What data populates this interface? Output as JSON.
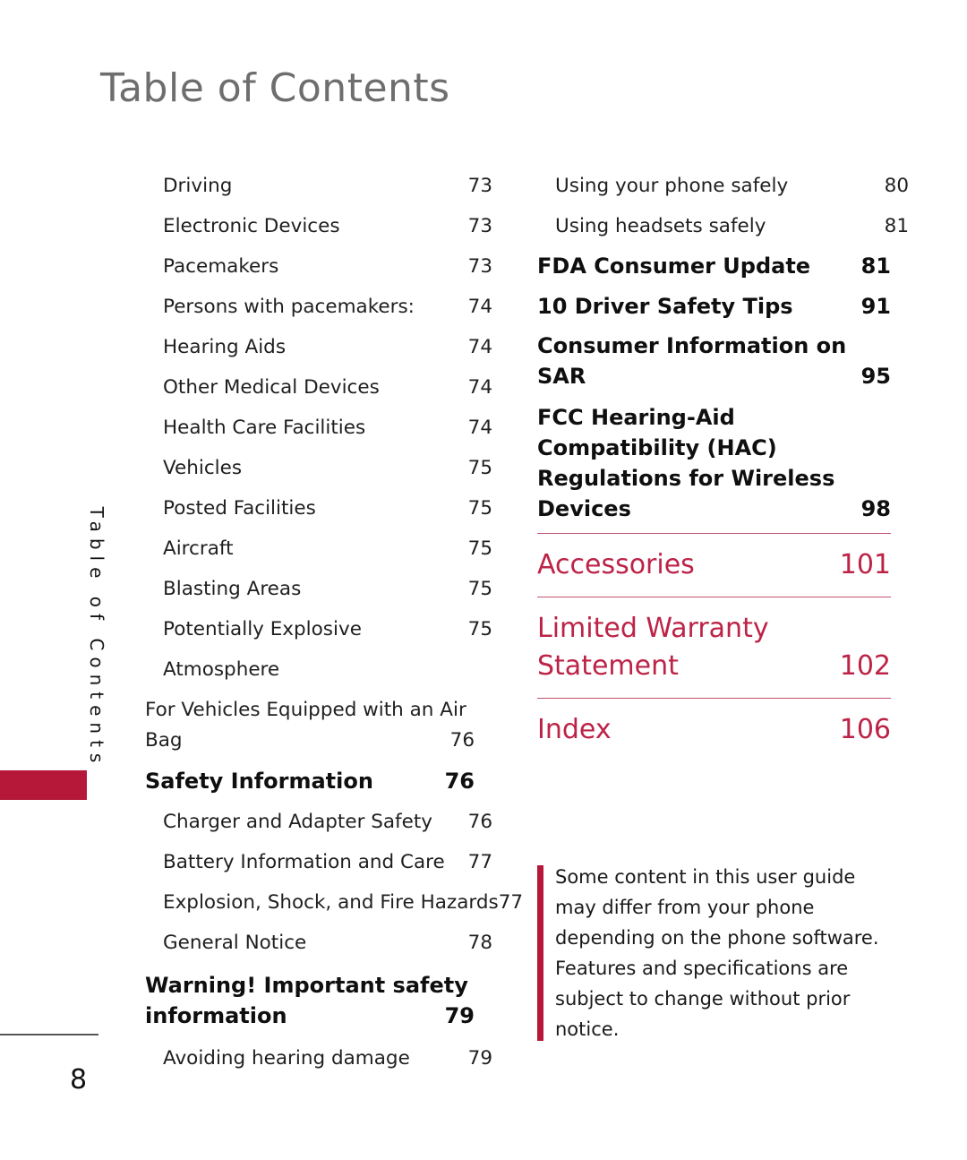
{
  "page": {
    "title": "Table of Contents",
    "side_tab_label": "Table of Contents",
    "page_number": "8",
    "accent_color": "#b51838",
    "major_color": "#bc2347",
    "title_color": "#6e6e6e"
  },
  "left_column": {
    "entries": [
      {
        "label": "Driving",
        "page": "73",
        "level": "sub"
      },
      {
        "label": "Electronic Devices",
        "page": "73",
        "level": "sub"
      },
      {
        "label": "Pacemakers",
        "page": "73",
        "level": "sub"
      },
      {
        "label": "Persons with pacemakers:",
        "page": "74",
        "level": "sub"
      },
      {
        "label": "Hearing Aids",
        "page": "74",
        "level": "sub"
      },
      {
        "label": "Other Medical Devices",
        "page": "74",
        "level": "sub"
      },
      {
        "label": "Health Care Facilities",
        "page": "74",
        "level": "sub"
      },
      {
        "label": "Vehicles",
        "page": "75",
        "level": "sub"
      },
      {
        "label": "Posted Facilities",
        "page": "75",
        "level": "sub"
      },
      {
        "label": "Aircraft",
        "page": "75",
        "level": "sub"
      },
      {
        "label": "Blasting Areas",
        "page": "75",
        "level": "sub"
      },
      {
        "label": "Potentially Explosive Atmosphere",
        "page": "75",
        "level": "sub"
      },
      {
        "label": "For Vehicles Equipped with an Air Bag",
        "page": "76",
        "level": "sub-multi"
      },
      {
        "label": "Safety Information",
        "page": "76",
        "level": "head"
      },
      {
        "label": "Charger and Adapter Safety",
        "page": "76",
        "level": "sub"
      },
      {
        "label": "Battery Information and Care",
        "page": "77",
        "level": "sub"
      },
      {
        "label": "Explosion, Shock, and Fire Hazards",
        "page": "77",
        "level": "sub"
      },
      {
        "label": "General Notice",
        "page": "78",
        "level": "sub"
      },
      {
        "label": "Warning! Important safety information",
        "page": "79",
        "level": "head-multi"
      },
      {
        "label": "Avoiding hearing damage",
        "page": "79",
        "level": "sub"
      }
    ]
  },
  "right_column": {
    "entries": [
      {
        "label": "Using your phone safely",
        "page": "80",
        "level": "sub"
      },
      {
        "label": "Using headsets safely",
        "page": "81",
        "level": "sub"
      },
      {
        "label": "FDA Consumer Update",
        "page": "81",
        "level": "head"
      },
      {
        "label": "10 Driver Safety Tips",
        "page": "91",
        "level": "head"
      },
      {
        "label": "Consumer Information on SAR",
        "page": "95",
        "level": "head-multi"
      },
      {
        "label": "FCC Hearing-Aid Compatibility (HAC) Regulations for Wireless Devices",
        "page": "98",
        "level": "head-multi"
      }
    ],
    "major_sections": [
      {
        "label": "Accessories",
        "page": "101"
      },
      {
        "label": "Limited Warranty Statement",
        "page": "102"
      },
      {
        "label": "Index",
        "page": "106"
      }
    ]
  },
  "note": {
    "text": "Some content in this user guide may differ from your phone depending on the phone software. Features and specifications are subject to change without prior notice."
  }
}
